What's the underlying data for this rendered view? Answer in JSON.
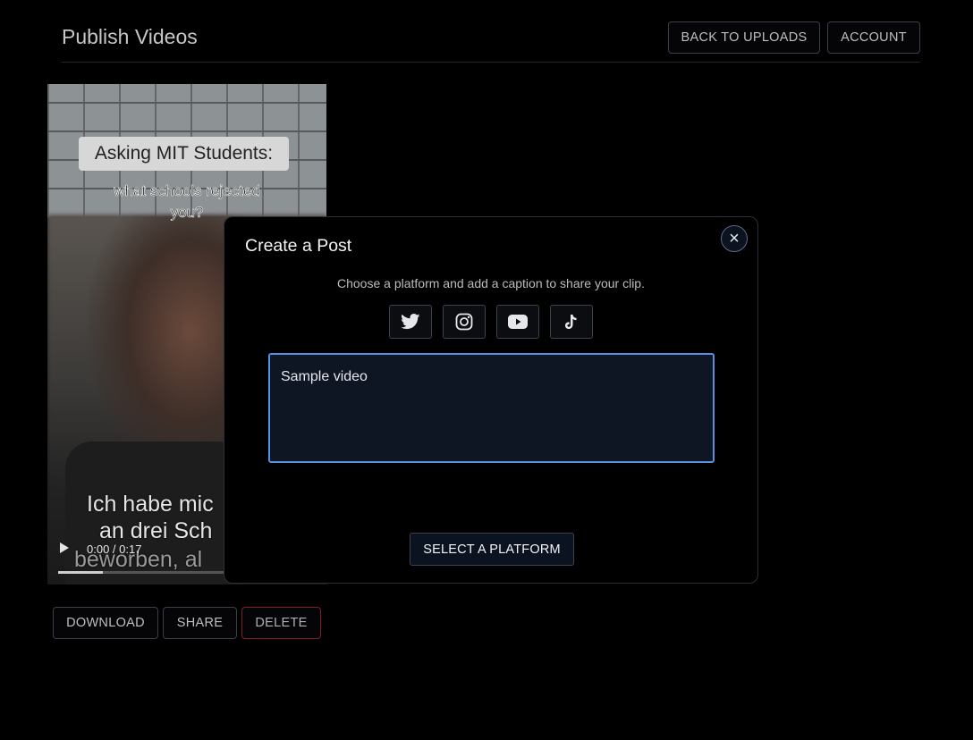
{
  "header": {
    "title": "Publish Videos",
    "back_label": "BACK TO UPLOADS",
    "account_label": "ACCOUNT"
  },
  "video": {
    "overlay_title": "Asking MIT Students:",
    "overlay_sub_1": "what schools rejected",
    "overlay_sub_2": "you?",
    "caption_line_1": "Ich habe mic",
    "caption_line_2": "an drei Sch",
    "caption_line_3": "beworben, al",
    "time": "0:00 / 0:17",
    "progress": 0.21
  },
  "actions": {
    "download_label": "DOWNLOAD",
    "share_label": "SHARE",
    "delete_label": "DELETE"
  },
  "modal": {
    "title": "Create a Post",
    "close_icon": "×",
    "description": "Choose a platform and add a caption to share your clip.",
    "platforms": [
      "twitter-icon",
      "instagram-icon",
      "youtube-icon",
      "tiktok-icon"
    ],
    "caption_value": "Sample video",
    "select_label": "SELECT A PLATFORM"
  },
  "colors": {
    "accent_border": "#5b8de0",
    "delete_border": "#7f1d2d",
    "background": "#000000"
  }
}
